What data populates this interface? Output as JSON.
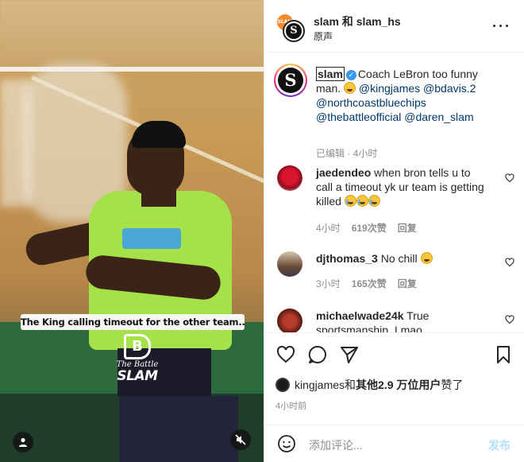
{
  "media": {
    "caption_overlay": "The King calling timeout for the other team..",
    "watermark_top": "The Battle",
    "watermark_bottom": "SLAM",
    "watermark_glyph": "B",
    "user_tag_icon": "person-icon",
    "mute_icon": "speaker-muted-icon"
  },
  "header": {
    "title": "slam 和 slam_hs",
    "subtitle": "原声",
    "more_icon": "more-horizontal-icon",
    "avatar_letter": "S",
    "small_avatar_text": "SLAM"
  },
  "post": {
    "username": "slam",
    "avatar_letter": "S",
    "text": "Coach LeBron too funny man.",
    "mentions": [
      "@kingjames",
      "@bdavis.2",
      "@northcoastbluechips",
      "@thebattleofficial",
      "@daren_slam"
    ],
    "meta": "已编辑 · 4小时"
  },
  "comments": [
    {
      "username": "jaedendeo",
      "text": "when bron tells u to call a timeout yk ur team is getting killed",
      "time": "4小时",
      "likes": "619次赞",
      "reply": "回复"
    },
    {
      "username": "djthomas_3",
      "text": "No chill",
      "time": "3小时",
      "likes": "165次赞",
      "reply": "回复"
    },
    {
      "username": "michaelwade24k",
      "text": "True",
      "text_cut": "sportsmanship. I mao",
      "time": "",
      "likes": "",
      "reply": ""
    }
  ],
  "actions": {
    "like_icon": "heart-icon",
    "comment_icon": "comment-icon",
    "share_icon": "paper-plane-icon",
    "save_icon": "bookmark-icon"
  },
  "likes": {
    "prefix": "kingjames和",
    "bold": "其他2.9 万位用户",
    "suffix": "赞了"
  },
  "timestamp": "4小时前",
  "composer": {
    "placeholder": "添加评论...",
    "publish": "发布",
    "emoji_icon": "smiley-icon"
  },
  "colors": {
    "link": "#00376b",
    "verified": "#3897f0",
    "publish_disabled": "#b2dffc",
    "meta_gray": "#8e8e8e"
  }
}
